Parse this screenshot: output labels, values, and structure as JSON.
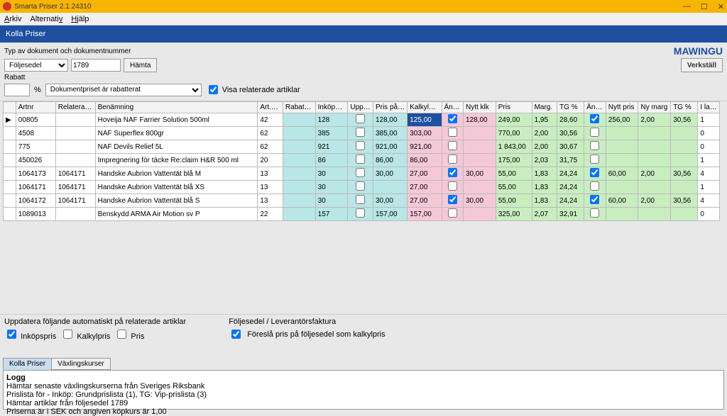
{
  "window": {
    "title": "Smarta Priser 2.1.24310"
  },
  "menu": {
    "arkiv": "Arkiv",
    "alternativ": "Alternativ",
    "hjalp": "Hjälp"
  },
  "header": {
    "title": "Kolla Priser"
  },
  "toolbar": {
    "doc_label": "Typ av dokument och dokumentnummer",
    "doc_type": "Följesedel",
    "doc_nr": "1789",
    "hamta": "Hämta",
    "rabatt_label": "Rabatt",
    "rabatt_val": "",
    "percent": "%",
    "rabatt_desc": "Dokumentpriset är rabatterat",
    "visa_rel": "Visa relaterade artiklar",
    "brand": "MAWINGU",
    "verkstall": "Verkställ"
  },
  "cols": {
    "artnr": "Artnr",
    "rel": "Relaterad till",
    "ben": "Benämning",
    "grp": "Art.grupp",
    "rab": "Rabatt %",
    "ink": "Inköpspris",
    "upp": "Uppdat.",
    "pris": "Pris på följ.",
    "kal": "Kalkylpris",
    "and": "Ändra",
    "nykl": "Nytt klk",
    "p": "Pris",
    "mrg": "Marg.",
    "tg": "TG %",
    "and2": "Ändra",
    "nyp": "Nytt pris",
    "nym": "Ny marg",
    "tg2": "TG %",
    "lag": "I lager"
  },
  "rows": [
    {
      "sel": "▶",
      "artnr": "00805",
      "rel": "",
      "ben": "Hoveija NAF Farrier Solution 500ml",
      "grp": "42",
      "rab": "",
      "ink": "128",
      "upp": false,
      "pris": "128,00",
      "kal": "125,00",
      "and": true,
      "nykl": "128,00",
      "p": "249,00",
      "mrg": "1,95",
      "tg": "28,60",
      "and2": true,
      "nyp": "256,00",
      "nym": "2,00",
      "tg2": "30,56",
      "lag": "1",
      "kalSel": true
    },
    {
      "artnr": "4508",
      "rel": "",
      "ben": "NAF Superflex 800gr",
      "grp": "62",
      "rab": "",
      "ink": "385",
      "upp": false,
      "pris": "385,00",
      "kal": "303,00",
      "and": false,
      "nykl": "",
      "p": "770,00",
      "mrg": "2,00",
      "tg": "30,56",
      "and2": false,
      "nyp": "",
      "nym": "",
      "tg2": "",
      "lag": "0"
    },
    {
      "artnr": "775",
      "rel": "",
      "ben": "NAF Devils Relief 5L",
      "grp": "62",
      "rab": "",
      "ink": "921",
      "upp": false,
      "pris": "921,00",
      "kal": "921,00",
      "and": false,
      "nykl": "",
      "p": "1 843,00",
      "mrg": "2,00",
      "tg": "30,67",
      "and2": false,
      "nyp": "",
      "nym": "",
      "tg2": "",
      "lag": "0"
    },
    {
      "artnr": "450026",
      "rel": "",
      "ben": "Impregnering för täcke Re:claim H&R 500 ml",
      "grp": "20",
      "rab": "",
      "ink": "86",
      "upp": false,
      "pris": "86,00",
      "kal": "86,00",
      "and": false,
      "nykl": "",
      "p": "175,00",
      "mrg": "2,03",
      "tg": "31,75",
      "and2": false,
      "nyp": "",
      "nym": "",
      "tg2": "",
      "lag": "1"
    },
    {
      "artnr": "1064173",
      "rel": "1064171",
      "ben": "Handske Aubrion Vattentät blå M",
      "grp": "13",
      "rab": "",
      "ink": "30",
      "upp": false,
      "pris": "30,00",
      "kal": "27,00",
      "and": true,
      "nykl": "30,00",
      "p": "55,00",
      "mrg": "1,83",
      "tg": "24,24",
      "and2": true,
      "nyp": "60,00",
      "nym": "2,00",
      "tg2": "30,56",
      "lag": "4"
    },
    {
      "artnr": "1064171",
      "rel": "1064171",
      "ben": "Handske Aubrion Vattentät blå XS",
      "grp": "13",
      "rab": "",
      "ink": "30",
      "upp": false,
      "pris": "",
      "kal": "27,00",
      "and": false,
      "nykl": "",
      "p": "55,00",
      "mrg": "1,83",
      "tg": "24,24",
      "and2": false,
      "nyp": "",
      "nym": "",
      "tg2": "",
      "lag": "1"
    },
    {
      "artnr": "1064172",
      "rel": "1064171",
      "ben": "Handske Aubrion Vattentät blå S",
      "grp": "13",
      "rab": "",
      "ink": "30",
      "upp": false,
      "pris": "30,00",
      "kal": "27,00",
      "and": true,
      "nykl": "30,00",
      "p": "55,00",
      "mrg": "1,83",
      "tg": "24,24",
      "and2": true,
      "nyp": "60,00",
      "nym": "2,00",
      "tg2": "30,56",
      "lag": "4"
    },
    {
      "artnr": "1089013",
      "rel": "",
      "ben": "Benskydd ARMA Air Motion sv P",
      "grp": "22",
      "rab": "",
      "ink": "157",
      "upp": false,
      "pris": "157,00",
      "kal": "157,00",
      "and": false,
      "nykl": "",
      "p": "325,00",
      "mrg": "2,07",
      "tg": "32,91",
      "and2": false,
      "nyp": "",
      "nym": "",
      "tg2": "",
      "lag": "0"
    }
  ],
  "footer": {
    "auto_label": "Uppdatera följande automatiskt på relaterade artiklar",
    "inkop": "Inköpspris",
    "kalkyl": "Kalkylpris",
    "pris": "Pris",
    "flev_label": "Följesedel / Leverantörsfaktura",
    "foresla": "Föreslå pris på följesedel som kalkylpris"
  },
  "tabs": {
    "kolla": "Kolla Priser",
    "vaxling": "Växlingskurser"
  },
  "log": {
    "title": "Logg",
    "l1": "Hämtar senaste växlingskurserna från Sveriges Riksbank",
    "l2": "Prislista för - Inköp: Grundprislista (1), TG: Vip-prislista (3)",
    "l3": "Hämtar artiklar från följesedel 1789",
    "l4": "Priserna är i SEK och angiven köpkurs är 1,00"
  }
}
